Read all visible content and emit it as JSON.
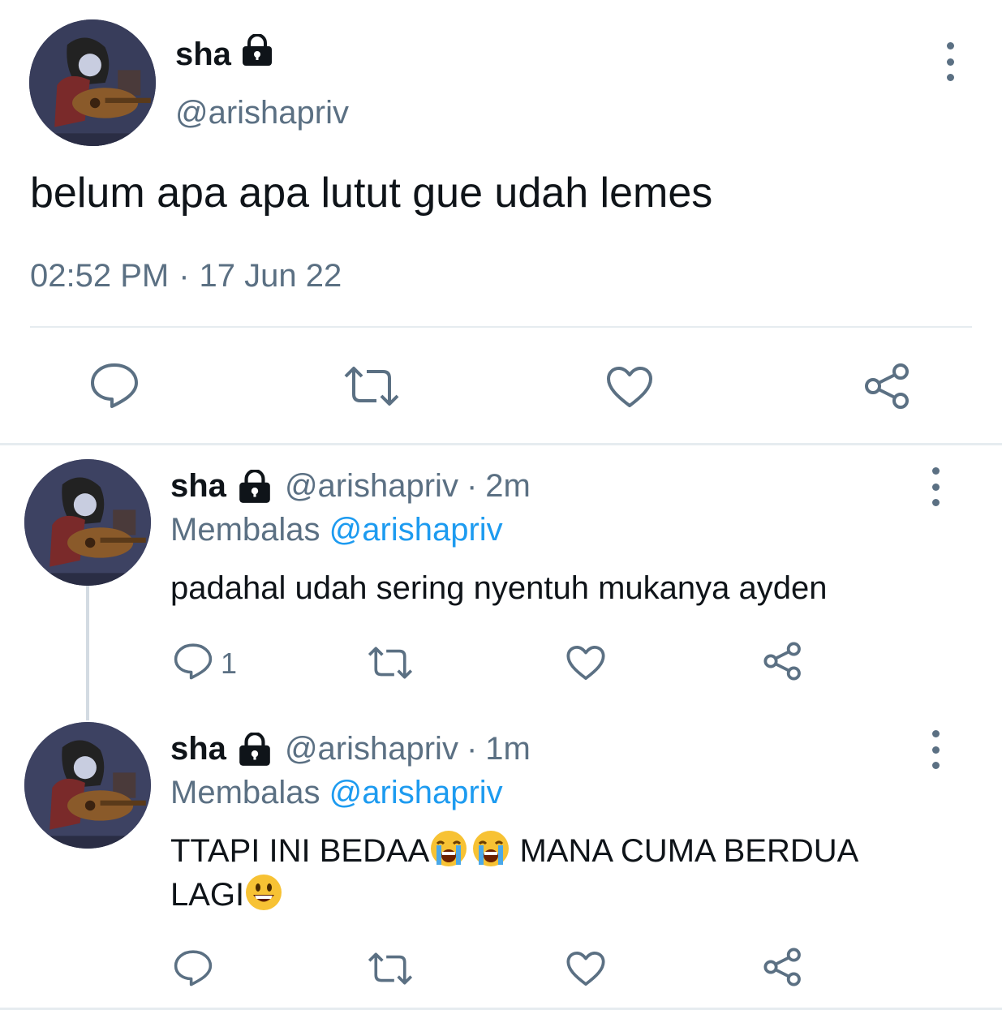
{
  "main_tweet": {
    "display_name": "sha",
    "handle": "@arishapriv",
    "text": "belum apa apa lutut gue udah lemes",
    "time": "02:52 PM",
    "separator": "·",
    "date": "17 Jun 22",
    "actions": [
      "reply-icon",
      "retweet-icon",
      "like-icon",
      "share-icon"
    ]
  },
  "replies": [
    {
      "display_name": "sha",
      "handle": "@arishapriv",
      "dot": "·",
      "age": "2m",
      "replying_prefix": "Membalas",
      "replying_to": "@arishapriv",
      "text": "padahal udah sering nyentuh mukanya ayden",
      "reply_count": "1"
    },
    {
      "display_name": "sha",
      "handle": "@arishapriv",
      "dot": "·",
      "age": "1m",
      "replying_prefix": "Membalas",
      "replying_to": "@arishapriv",
      "text_part1": "TTAPI INI BEDAA",
      "text_part2": " MANA CUMA BERDUA",
      "text_part3": "LAGI",
      "emojis": [
        "loudly-crying-face",
        "loudly-crying-face",
        "grinning-face"
      ]
    }
  ],
  "colors": {
    "text": "#0f1419",
    "secondary": "#5b7083",
    "link": "#1d9bf0",
    "divider": "#e6ecf0"
  }
}
